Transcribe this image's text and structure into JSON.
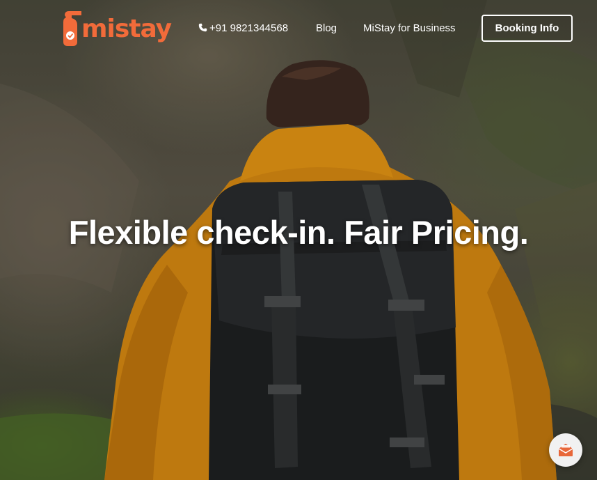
{
  "brand": {
    "name": "mistay",
    "accent_color": "#f26b3a"
  },
  "nav": {
    "phone_icon": "phone-icon",
    "phone": "+91 9821344568",
    "blog": "Blog",
    "business": "MiStay for Business",
    "booking": "Booking Info"
  },
  "hero": {
    "headline": "Flexible check-in. Fair Pricing."
  },
  "chat": {
    "icon": "envelope-icon"
  }
}
